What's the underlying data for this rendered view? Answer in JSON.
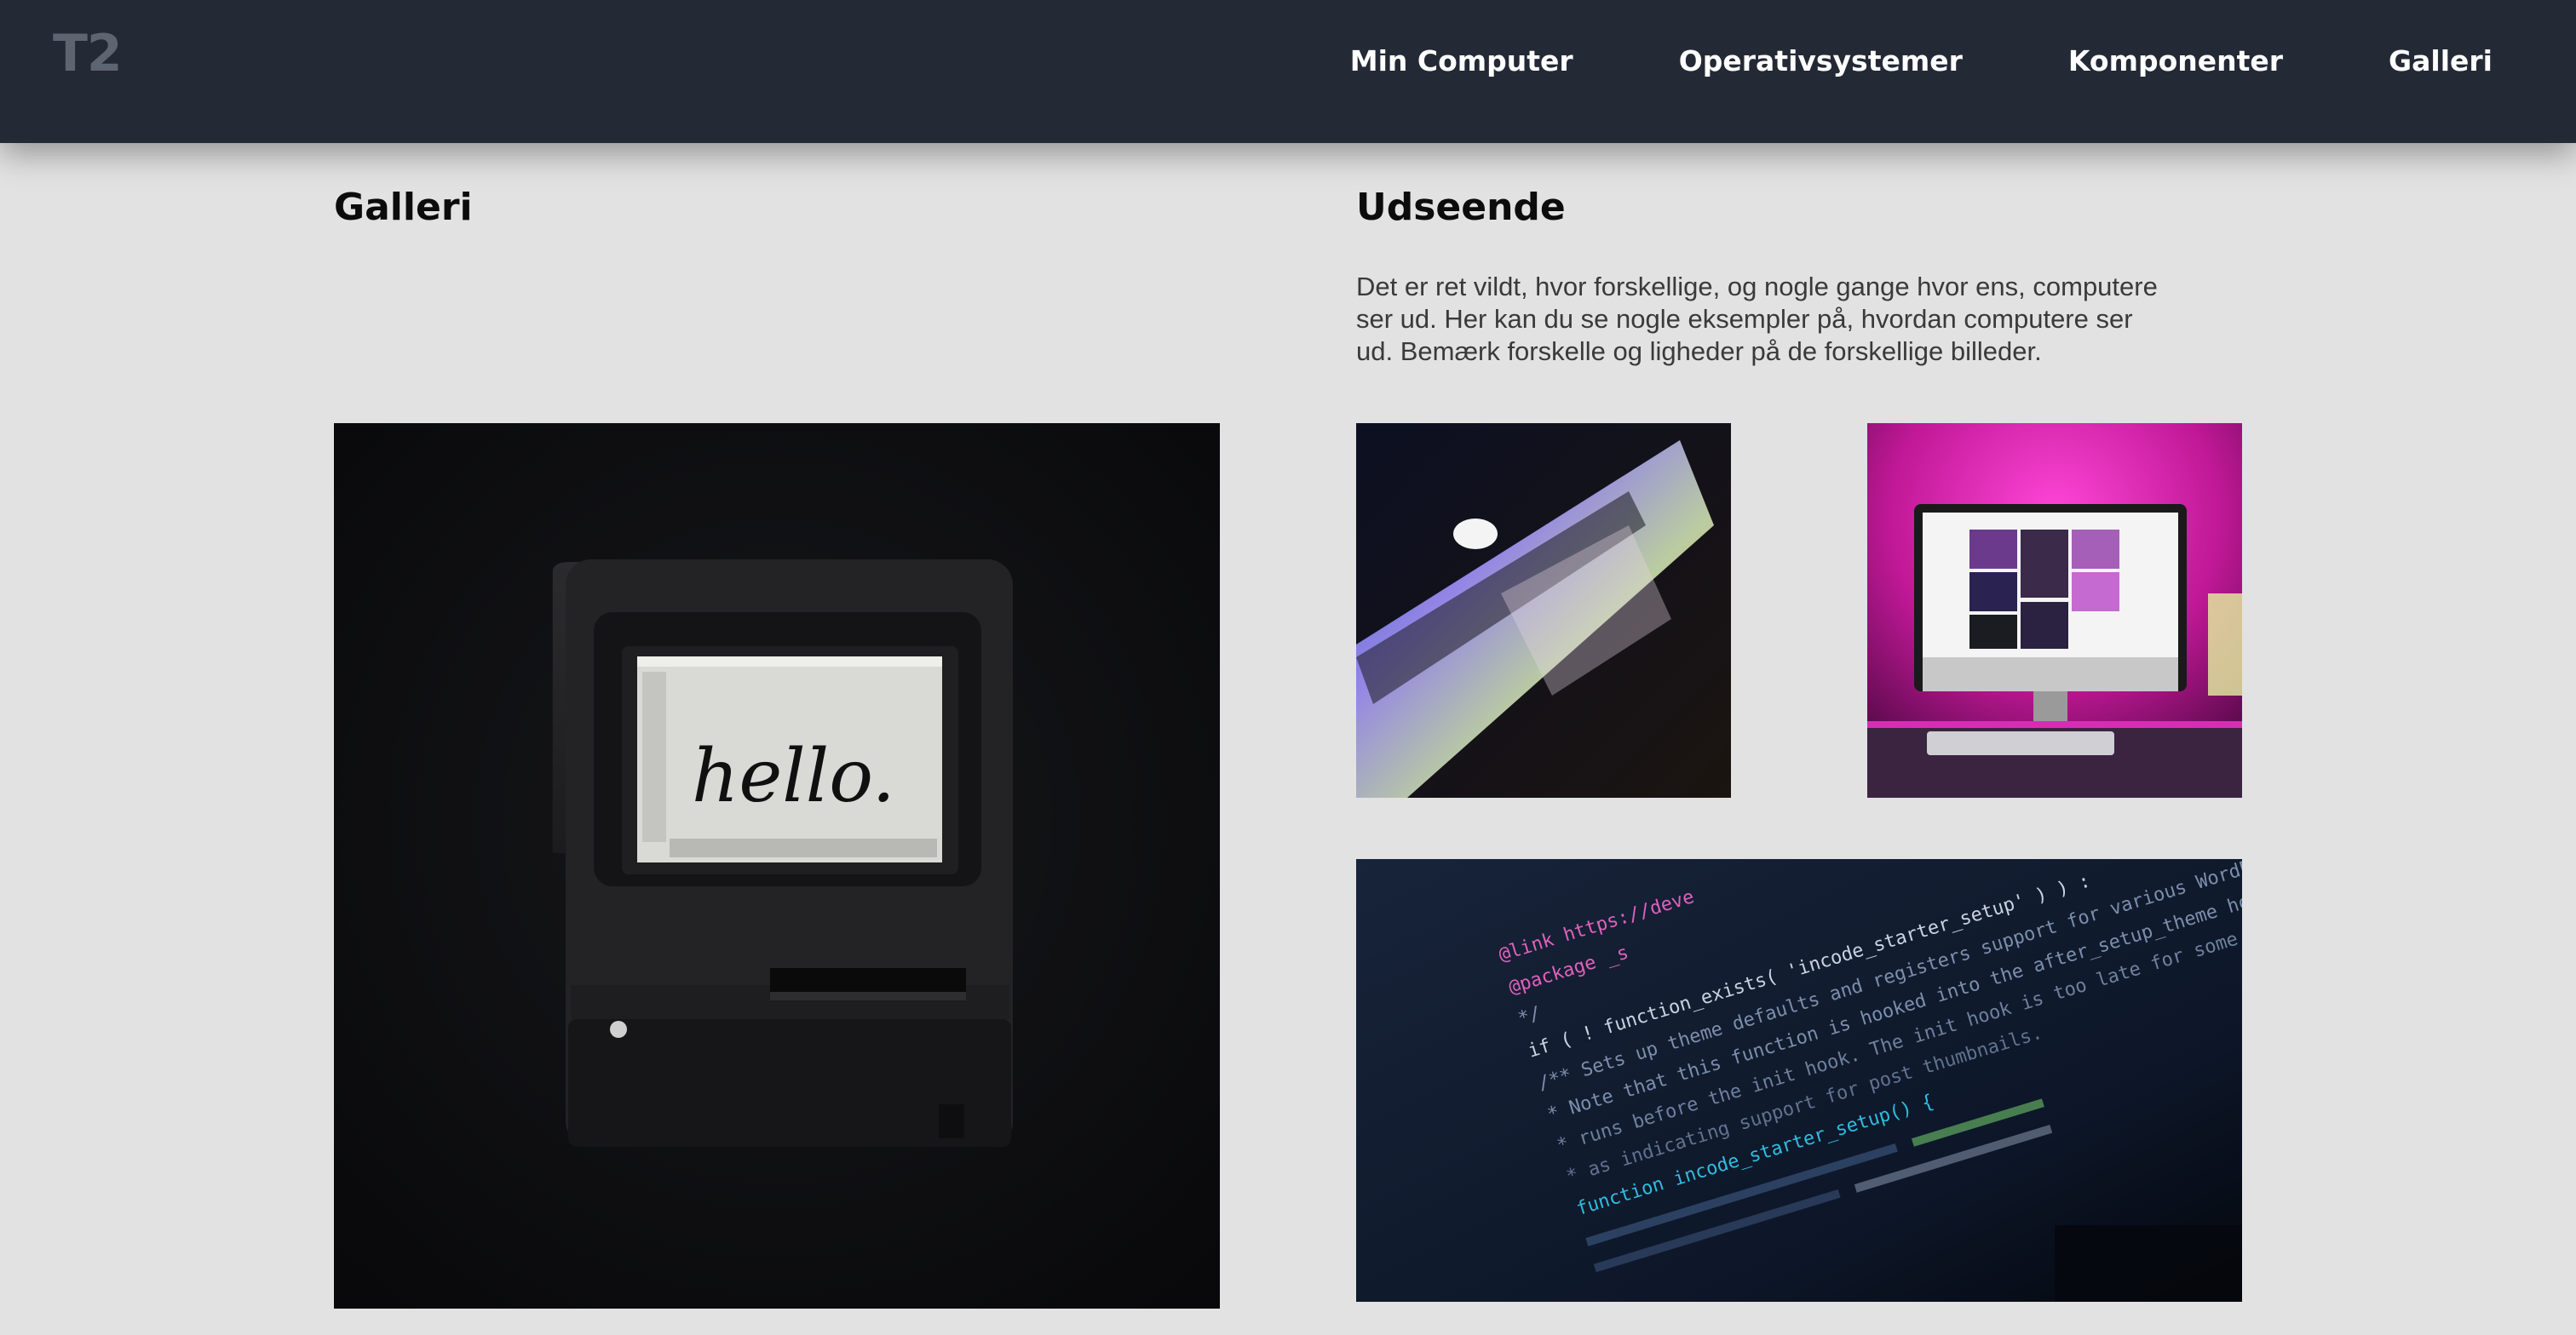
{
  "header": {
    "logo": "T2",
    "nav": [
      {
        "label": "Min Computer"
      },
      {
        "label": "Operativsystemer"
      },
      {
        "label": "Komponenter"
      },
      {
        "label": "Galleri"
      }
    ]
  },
  "main": {
    "gallery_title": "Galleri",
    "appearance_title": "Udseende",
    "appearance_text": "Det er ret vildt, hvor forskellige, og nogle gange hvor ens, computere ser ud. Her kan du se nogle eksempler på, hvordan computere ser ud. Bemærk forskelle og ligheder på de forskellige billeder."
  },
  "images": {
    "mac_screen_text": "hello.",
    "code_lines": [
      "@link https://deve",
      "@package _s",
      "*/",
      "if ( ! function_exists( 'incode_starter_setup' ) ) :",
      "/** Sets up theme defaults and registers support for various WordPress features.",
      " * Note that this function is hooked into the after_setup_theme hook, which",
      " * runs before the init hook. The init hook is too late for some features, such",
      " * as indicating support for post thumbnails.",
      "function incode_starter_setup() {"
    ]
  },
  "colors": {
    "header_bg": "#242936",
    "page_bg": "#e2e2e2",
    "logo": "#5d6570"
  }
}
